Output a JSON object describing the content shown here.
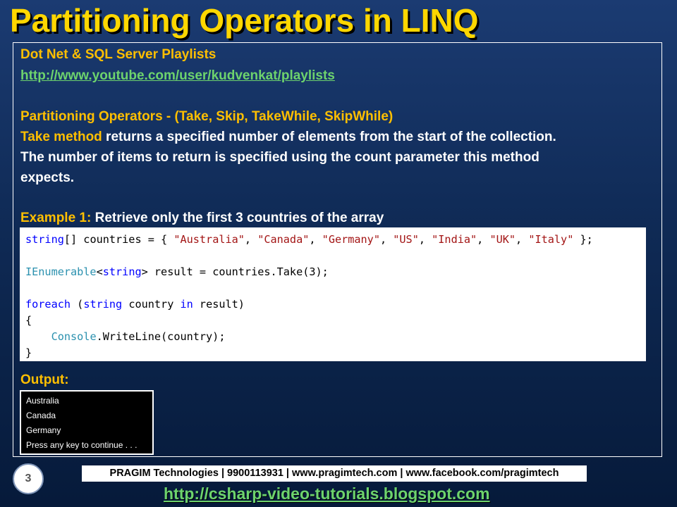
{
  "slide": {
    "title": "Partitioning Operators in LINQ",
    "playlist_heading": "Dot Net & SQL Server Playlists",
    "playlist_url": "http://www.youtube.com/user/kudvenkat/playlists",
    "operators_heading": "Partitioning Operators - (Take, Skip, TakeWhile, SkipWhile)",
    "take_label": "Take method",
    "take_desc_1": " returns a specified number of elements from the start of the collection.",
    "take_desc_2": "The number of items to return is specified using the count parameter this method",
    "take_desc_3": "expects.",
    "example_label": "Example 1:",
    "example_desc": " Retrieve only the first 3 countries of the array",
    "code": {
      "l1_kw": "string",
      "l1_a": "[] countries = { ",
      "l1_s1": "\"Australia\"",
      "l1_s2": "\"Canada\"",
      "l1_s3": "\"Germany\"",
      "l1_s4": "\"US\"",
      "l1_s5": "\"India\"",
      "l1_s6": "\"UK\"",
      "l1_s7": "\"Italy\"",
      "sep": ", ",
      "l1_end": " };",
      "l3_ty": "IEnumerable",
      "l3_lt": "<",
      "l3_kw": "string",
      "l3_rest": "> result = countries.Take(3);",
      "l5_kw1": "foreach",
      "l5_a": " (",
      "l5_kw2": "string",
      "l5_b": " country ",
      "l5_kw3": "in",
      "l5_c": " result)",
      "l6": "{",
      "l7_indent": "    ",
      "l7_ty": "Console",
      "l7_rest": ".WriteLine(country);",
      "l8": "}"
    },
    "output_label": "Output:",
    "output_lines": [
      "Australia",
      "Canada",
      "Germany",
      "Press any key to continue . . ."
    ],
    "slide_number": "3",
    "footer": "PRAGIM Technologies | 9900113931 | www.pragimtech.com | www.facebook.com/pragimtech",
    "blog_url": "http://csharp-video-tutorials.blogspot.com"
  }
}
